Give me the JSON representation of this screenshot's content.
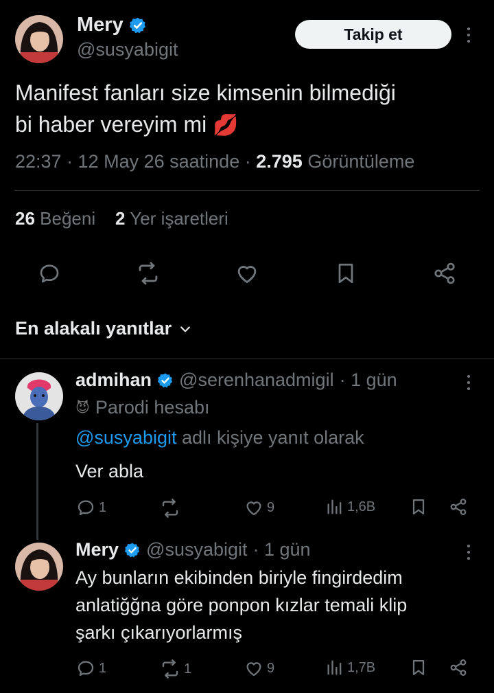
{
  "main_tweet": {
    "author_name": "Mery",
    "handle": "@susyabigit",
    "follow_label": "Takip et",
    "text_line1": "Manifest fanları size kimsenin bilmediği",
    "text_line2": "bi haber vereyim mi",
    "emoji": "💋",
    "time": "22:37 · 12 May 26 saatinde ·",
    "views_count": "2.795",
    "views_label": "Görüntüleme",
    "likes_count": "26",
    "likes_label": "Beğeni",
    "bookmarks_count": "2",
    "bookmarks_label": "Yer işaretleri"
  },
  "sort_label": "En alakalı yanıtlar",
  "replies": [
    {
      "author_name": "admihan",
      "handle": "@serenhanadmigil",
      "time": "· 1 gün",
      "label_icon": "😈",
      "label_text": "Parodi hesabı",
      "reply_to_mention": "@susyabigit",
      "reply_to_suffix": "adlı kişiye yanıt olarak",
      "text": "Ver abla",
      "reply_count": "1",
      "retweet_count": "",
      "like_count": "9",
      "view_count": "1,6B"
    },
    {
      "author_name": "Mery",
      "handle": "@susyabigit",
      "time": "· 1 gün",
      "text_line1": "Ay bunların ekibinden biriyle fingirdedim",
      "text_line2": "anlatiğğna göre ponpon kızlar temali klip",
      "text_line3": "şarkı çıkarıyorlarmış",
      "reply_count": "1",
      "retweet_count": "1",
      "like_count": "9",
      "view_count": "1,7B"
    }
  ],
  "colors": {
    "background": "#000000",
    "text": "#e7e9ea",
    "secondary": "#71767b",
    "verified": "#1d9bf0",
    "mention": "#1d9bf0",
    "divider": "#2f3336"
  }
}
